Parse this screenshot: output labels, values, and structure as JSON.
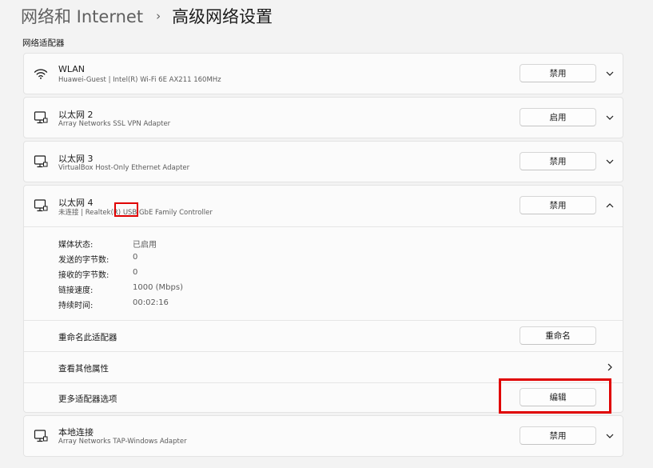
{
  "breadcrumb": {
    "parent": "网络和 Internet",
    "separator": "›",
    "current": "高级网络设置"
  },
  "section_title": "网络适配器",
  "adapters": [
    {
      "name": "WLAN",
      "description": "Huawei-Guest | Intel(R) Wi-Fi 6E AX211 160MHz",
      "button": "禁用",
      "icon": "wifi-icon",
      "expanded": false
    },
    {
      "name": "以太网 2",
      "description": "Array Networks SSL VPN Adapter",
      "button": "启用",
      "icon": "ethernet-icon",
      "expanded": false
    },
    {
      "name": "以太网 3",
      "description": "VirtualBox Host-Only Ethernet Adapter",
      "button": "禁用",
      "icon": "ethernet-icon",
      "expanded": false
    },
    {
      "name": "以太网 4",
      "description": "未连接 | Realtek(R) USB GbE Family Controller",
      "button": "禁用",
      "icon": "ethernet-icon",
      "expanded": true,
      "details": [
        {
          "label": "媒体状态:",
          "value": "已启用"
        },
        {
          "label": "发送的字节数:",
          "value": "0"
        },
        {
          "label": "接收的字节数:",
          "value": "0"
        },
        {
          "label": "链接速度:",
          "value": "1000 (Mbps)"
        },
        {
          "label": "持续时间:",
          "value": "00:02:16"
        }
      ],
      "rename_label": "重命名此适配器",
      "rename_button": "重命名",
      "more_properties_label": "查看其他属性",
      "more_options_label": "更多适配器选项",
      "edit_button": "编辑"
    },
    {
      "name": "本地连接",
      "description": "Array Networks TAP-Windows Adapter",
      "button": "禁用",
      "icon": "ethernet-icon",
      "expanded": false
    }
  ],
  "colors": {
    "background": "#f3f3f3",
    "card": "#fbfbfb",
    "highlight": "#e00000"
  }
}
